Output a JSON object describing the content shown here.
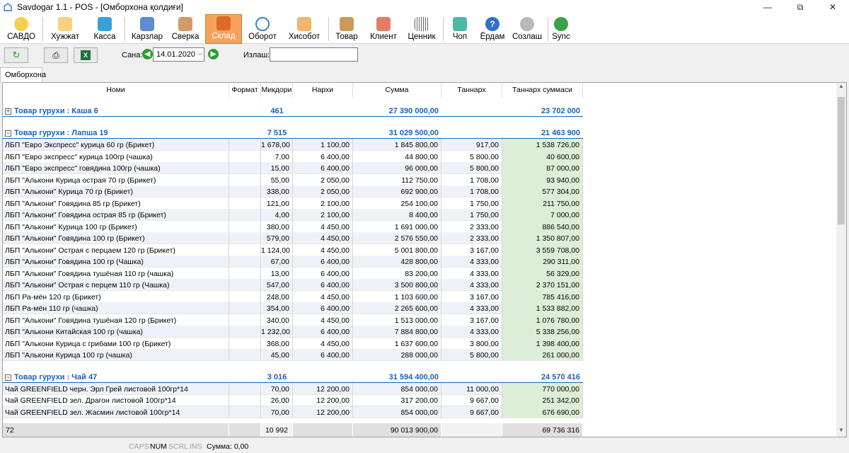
{
  "window": {
    "title": "Savdogar 1.1 - POS - [Омборхона қолдиғи]"
  },
  "toolbar": {
    "items": [
      {
        "label": "САВДО",
        "icon": "bulb-icon"
      },
      {
        "label": "Хужжат",
        "icon": "document-add-icon"
      },
      {
        "label": "Касса",
        "icon": "cash-icon"
      },
      {
        "label": "Карзлар",
        "icon": "debts-icon"
      },
      {
        "label": "Сверка",
        "icon": "reconcile-icon"
      },
      {
        "label": "Склад",
        "icon": "warehouse-icon"
      },
      {
        "label": "Оборот",
        "icon": "turnover-icon"
      },
      {
        "label": "Хисобот",
        "icon": "report-icon"
      },
      {
        "label": "Товар",
        "icon": "product-icon"
      },
      {
        "label": "Клиент",
        "icon": "client-icon"
      },
      {
        "label": "Ценник",
        "icon": "barcode-icon"
      },
      {
        "label": "Чоп",
        "icon": "print-icon"
      },
      {
        "label": "Ёрдам",
        "icon": "help-icon"
      },
      {
        "label": "Созлаш",
        "icon": "settings-icon"
      },
      {
        "label": "Sync",
        "icon": "sync-icon"
      }
    ]
  },
  "filter": {
    "date_label": "Сана:",
    "date_value": "14.01.2020",
    "search_label": "Излаш:",
    "search_value": ""
  },
  "tab": {
    "label": "Омборхона"
  },
  "columns": {
    "name": "Номи",
    "format": "Формат",
    "qty": "Микдори",
    "price": "Нархи",
    "sum": "Сумма",
    "cost": "Таннарх",
    "cost_sum": "Таннарх суммаси"
  },
  "groups": [
    {
      "title": "Товар гурухи : Каша 6",
      "qty": "461",
      "sum": "27 390 000,00",
      "cost_sum": "23 702 000",
      "expanded": false
    },
    {
      "title": "Товар гурухи : Лапша 19",
      "qty": "7 515",
      "sum": "31 029 500,00",
      "cost_sum": "21 463 900",
      "expanded": true
    },
    {
      "title": "Товар гурухи : Чай 47",
      "qty": "3 016",
      "sum": "31 594 400,00",
      "cost_sum": "24 570 416",
      "expanded": true
    }
  ],
  "rows_lapsha": [
    {
      "name": "ЛБП  \"Евро Экспресс\" курица 60 гр (Брикет)",
      "qty": "1 678,00",
      "price": "1 100,00",
      "sum": "1 845 800,00",
      "cost": "917,00",
      "cost_sum": "1 538 726,00"
    },
    {
      "name": "ЛБП \"Евро экспресс\" курица 100гр (чашка)",
      "qty": "7,00",
      "price": "6 400,00",
      "sum": "44 800,00",
      "cost": "5 800,00",
      "cost_sum": "40 600,00"
    },
    {
      "name": "ЛБП \"Евро экспресс\" говядина 100гр (чашка)",
      "qty": "15,00",
      "price": "6 400,00",
      "sum": "96 000,00",
      "cost": "5 800,00",
      "cost_sum": "87 000,00"
    },
    {
      "name": "ЛБП \"Алькони Курица острая 70 гр (Брикет)",
      "qty": "55,00",
      "price": "2 050,00",
      "sum": "112 750,00",
      "cost": "1 708,00",
      "cost_sum": "93 940,00"
    },
    {
      "name": "ЛБП \"Алькони\" Курица  70 гр (Брикет)",
      "qty": "338,00",
      "price": "2 050,00",
      "sum": "692 900,00",
      "cost": "1 708,00",
      "cost_sum": "577 304,00"
    },
    {
      "name": "ЛБП \"Алькони\" Говядина  85 гр (Брикет)",
      "qty": "121,00",
      "price": "2 100,00",
      "sum": "254 100,00",
      "cost": "1 750,00",
      "cost_sum": "211 750,00"
    },
    {
      "name": "ЛБП \"Алькони\" Говядина острая  85 гр  (Брикет)",
      "qty": "4,00",
      "price": "2 100,00",
      "sum": "8 400,00",
      "cost": "1 750,00",
      "cost_sum": "7 000,00"
    },
    {
      "name": "ЛБП \"Алькони\" Курица  100 гр (Брикет)",
      "qty": "380,00",
      "price": "4 450,00",
      "sum": "1 691 000,00",
      "cost": "2 333,00",
      "cost_sum": "886 540,00"
    },
    {
      "name": "ЛБП \"Алькони\" Говядина 100 гр  (Брикет)",
      "qty": "579,00",
      "price": "4 450,00",
      "sum": "2 576 550,00",
      "cost": "2 333,00",
      "cost_sum": "1 350 807,00"
    },
    {
      "name": "ЛБП \"Алькони\" Острая с перцаем 120 гр  (Брикет)",
      "qty": "1 124,00",
      "price": "4 450,00",
      "sum": "5 001 800,00",
      "cost": "3 167,00",
      "cost_sum": "3 559 708,00"
    },
    {
      "name": "ЛБП \"Алькони\" Говядина 100 гр  (Чашка)",
      "qty": "67,00",
      "price": "6 400,00",
      "sum": "428 800,00",
      "cost": "4 333,00",
      "cost_sum": "290 311,00"
    },
    {
      "name": "ЛБП \"Алькони\" Говядина тушёная  110 гр (чашка)",
      "qty": "13,00",
      "price": "6 400,00",
      "sum": "83 200,00",
      "cost": "4 333,00",
      "cost_sum": "56 329,00"
    },
    {
      "name": "ЛБП \"Алькони\" Острая с перцем 110  гр  (Чашка)",
      "qty": "547,00",
      "price": "6 400,00",
      "sum": "3 500 800,00",
      "cost": "4 333,00",
      "cost_sum": "2 370 151,00"
    },
    {
      "name": "ЛБП Ра-мён 120 гр (Брикет)",
      "qty": "248,00",
      "price": "4 450,00",
      "sum": "1 103 600,00",
      "cost": "3 167,00",
      "cost_sum": "785 416,00"
    },
    {
      "name": "ЛБП Ра-мён 110 гр (чашка)",
      "qty": "354,00",
      "price": "6 400,00",
      "sum": "2 265 600,00",
      "cost": "4 333,00",
      "cost_sum": "1 533 882,00"
    },
    {
      "name": "ЛБП \"Алькони\" Говядина тушёная  120 гр (Брикет)",
      "qty": "340,00",
      "price": "4 450,00",
      "sum": "1 513 000,00",
      "cost": "3 167,00",
      "cost_sum": "1 076 780,00"
    },
    {
      "name": "ЛБП \"Алькони Китайская  100 гр (чашка)",
      "qty": "1 232,00",
      "price": "6 400,00",
      "sum": "7 884 800,00",
      "cost": "4 333,00",
      "cost_sum": "5 338 256,00"
    },
    {
      "name": "ЛБП \"Алькони Курица с грибами 100 гр (Брикет)",
      "qty": "368,00",
      "price": "4 450,00",
      "sum": "1 637 600,00",
      "cost": "3 800,00",
      "cost_sum": "1 398 400,00"
    },
    {
      "name": "ЛБП \"Алькони Курица  100 гр (чашка)",
      "qty": "45,00",
      "price": "6 400,00",
      "sum": "288 000,00",
      "cost": "5 800,00",
      "cost_sum": "261 000,00"
    }
  ],
  "rows_chai": [
    {
      "name": "Чай GREENFIELD черн. Эрл Грей листовой 100гр*14",
      "qty": "70,00",
      "price": "12 200,00",
      "sum": "854 000,00",
      "cost": "11 000,00",
      "cost_sum": "770 000,00"
    },
    {
      "name": "Чай GREENFIELD зел. Драгон листовой 100гр*14",
      "qty": "26,00",
      "price": "12 200,00",
      "sum": "317 200,00",
      "cost": "9 667,00",
      "cost_sum": "251 342,00"
    },
    {
      "name": "Чай GREENFIELD зел. Жасмин листовой 100гр*14",
      "qty": "70,00",
      "price": "12 200,00",
      "sum": "854 000,00",
      "cost": "9 667,00",
      "cost_sum": "676 690,00"
    }
  ],
  "footer": {
    "count": "72",
    "qty": "10 992",
    "sum": "90 013 900,00",
    "cost_sum": "69 736 316"
  },
  "status": {
    "caps": "CAPS",
    "num": "NUM",
    "scrl": "SCRL",
    "ins": "INS",
    "sum_label": "Сумма: 0,00"
  }
}
